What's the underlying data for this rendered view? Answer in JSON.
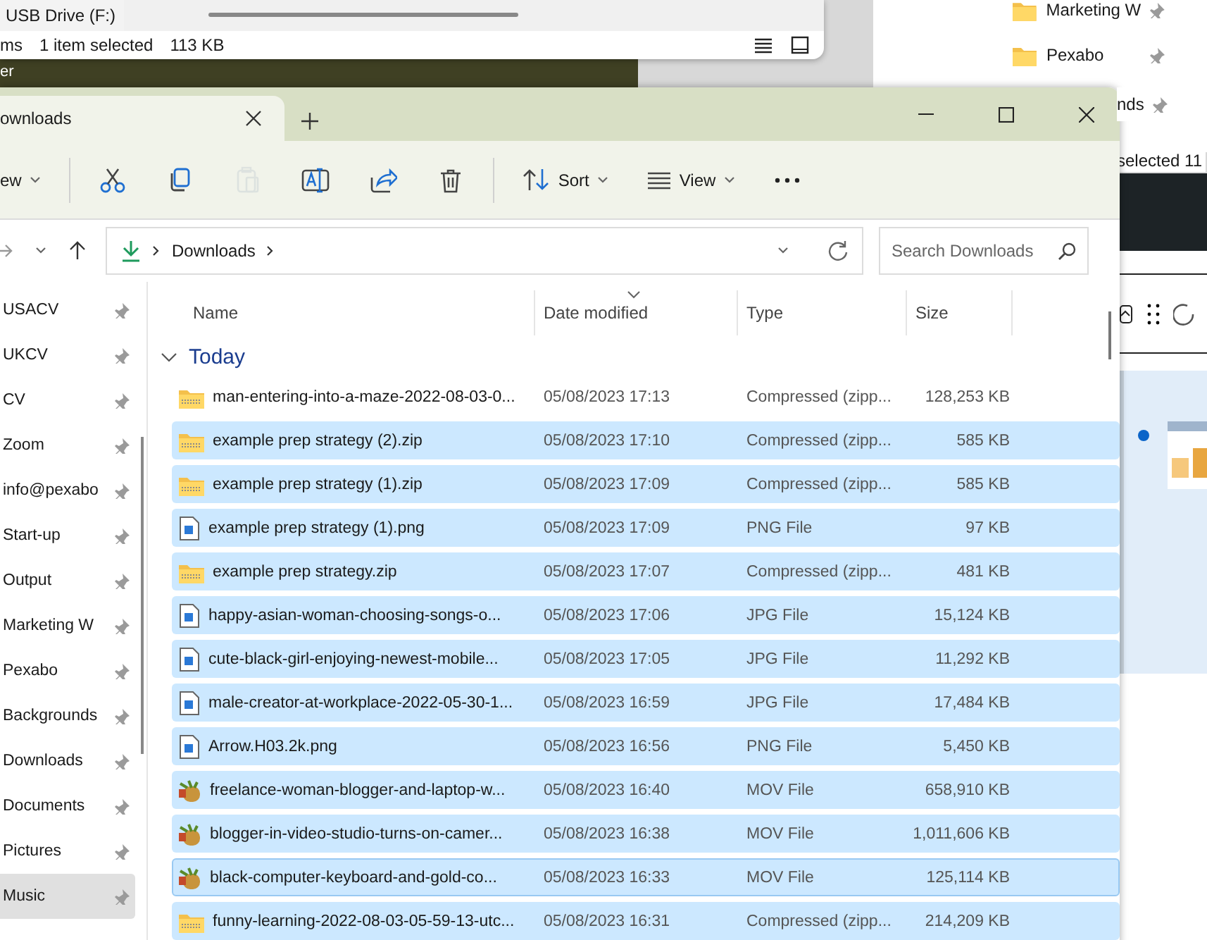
{
  "background_window_left": {
    "drive_label": "USB Drive (F:)",
    "status_count": "ms",
    "status_selected": "1 item selected",
    "status_size": "113 KB"
  },
  "desktop_label": "er",
  "background_window_right": {
    "quick_access": [
      {
        "label": "Marketing W"
      },
      {
        "label": "Pexabo"
      }
    ],
    "quick_access_partial": {
      "label": "nds"
    },
    "status": "selected  11"
  },
  "window": {
    "tabs": [
      {
        "label": "ownloads",
        "selected": true
      }
    ]
  },
  "toolbar": {
    "new_label": "ew",
    "buttons": [
      {
        "kind": "cut",
        "disabled": false
      },
      {
        "kind": "copy",
        "disabled": false
      },
      {
        "kind": "paste",
        "disabled": true
      },
      {
        "kind": "rename",
        "disabled": false
      },
      {
        "kind": "share",
        "disabled": false
      },
      {
        "kind": "delete",
        "disabled": false
      }
    ],
    "sort_label": "Sort",
    "view_label": "View"
  },
  "address_bar": {
    "location": "Downloads"
  },
  "search": {
    "placeholder": "Search Downloads"
  },
  "sidebar": {
    "items": [
      {
        "label": "USACV",
        "selected": false
      },
      {
        "label": "UKCV",
        "selected": false
      },
      {
        "label": "CV",
        "selected": false
      },
      {
        "label": "Zoom",
        "selected": false
      },
      {
        "label": "info@pexabo",
        "selected": false
      },
      {
        "label": "Start-up",
        "selected": false
      },
      {
        "label": "Output",
        "selected": false
      },
      {
        "label": "Marketing W",
        "selected": false
      },
      {
        "label": "Pexabo",
        "selected": false
      },
      {
        "label": "Backgrounds",
        "selected": false
      },
      {
        "label": "Downloads",
        "selected": false
      },
      {
        "label": "Documents",
        "selected": false
      },
      {
        "label": "Pictures",
        "selected": false
      },
      {
        "label": "Music",
        "selected": true
      }
    ]
  },
  "table": {
    "columns": [
      {
        "label": "Name",
        "sorted": false
      },
      {
        "label": "Date modified",
        "sorted": true
      },
      {
        "label": "Type",
        "sorted": false
      },
      {
        "label": "Size",
        "sorted": false
      }
    ],
    "group": {
      "label": "Today",
      "expanded": true
    },
    "rows": [
      {
        "kind": "zip",
        "name": "man-entering-into-a-maze-2022-08-03-0...",
        "date": "05/08/2023 17:13",
        "type": "Compressed (zipp...",
        "size": "128,253 KB",
        "selected": false,
        "focused": false
      },
      {
        "kind": "zip",
        "name": "example prep strategy (2).zip",
        "date": "05/08/2023 17:10",
        "type": "Compressed (zipp...",
        "size": "585 KB",
        "selected": true,
        "focused": false
      },
      {
        "kind": "zip",
        "name": "example prep strategy (1).zip",
        "date": "05/08/2023 17:09",
        "type": "Compressed (zipp...",
        "size": "585 KB",
        "selected": true,
        "focused": false
      },
      {
        "kind": "image",
        "name": "example prep strategy (1).png",
        "date": "05/08/2023 17:09",
        "type": "PNG File",
        "size": "97 KB",
        "selected": true,
        "focused": false
      },
      {
        "kind": "zip",
        "name": "example prep strategy.zip",
        "date": "05/08/2023 17:07",
        "type": "Compressed (zipp...",
        "size": "481 KB",
        "selected": true,
        "focused": false
      },
      {
        "kind": "image",
        "name": "happy-asian-woman-choosing-songs-o...",
        "date": "05/08/2023 17:06",
        "type": "JPG File",
        "size": "15,124 KB",
        "selected": true,
        "focused": false
      },
      {
        "kind": "image",
        "name": "cute-black-girl-enjoying-newest-mobile...",
        "date": "05/08/2023 17:05",
        "type": "JPG File",
        "size": "11,292 KB",
        "selected": true,
        "focused": false
      },
      {
        "kind": "image",
        "name": "male-creator-at-workplace-2022-05-30-1...",
        "date": "05/08/2023 16:59",
        "type": "JPG File",
        "size": "17,484 KB",
        "selected": true,
        "focused": false
      },
      {
        "kind": "image",
        "name": "Arrow.H03.2k.png",
        "date": "05/08/2023 16:56",
        "type": "PNG File",
        "size": "5,450 KB",
        "selected": true,
        "focused": false
      },
      {
        "kind": "video",
        "name": "freelance-woman-blogger-and-laptop-w...",
        "date": "05/08/2023 16:40",
        "type": "MOV File",
        "size": "658,910 KB",
        "selected": true,
        "focused": false
      },
      {
        "kind": "video",
        "name": "blogger-in-video-studio-turns-on-camer...",
        "date": "05/08/2023 16:38",
        "type": "MOV File",
        "size": "1,011,606 KB",
        "selected": true,
        "focused": false
      },
      {
        "kind": "video",
        "name": "black-computer-keyboard-and-gold-co...",
        "date": "05/08/2023 16:33",
        "type": "MOV File",
        "size": "125,114 KB",
        "selected": true,
        "focused": true
      },
      {
        "kind": "zip",
        "name": "funny-learning-2022-08-03-05-59-13-utc...",
        "date": "05/08/2023 16:31",
        "type": "Compressed (zipp...",
        "size": "214,209 KB",
        "selected": true,
        "focused": false
      }
    ]
  }
}
